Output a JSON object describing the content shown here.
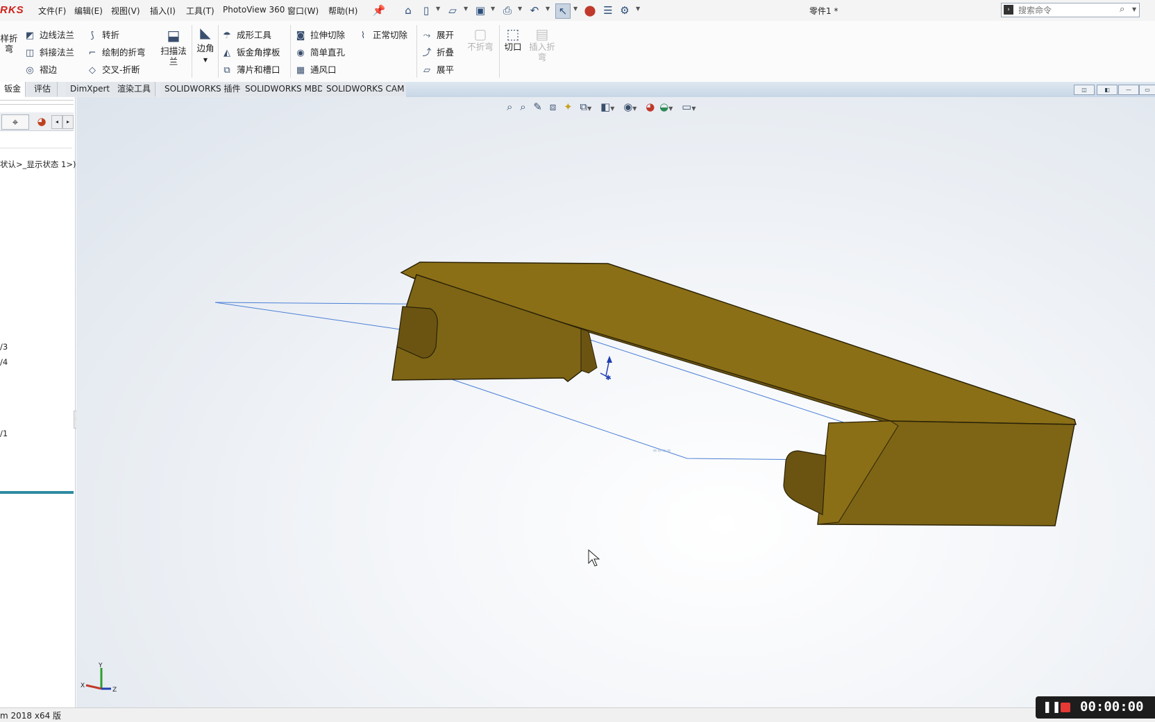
{
  "menubar": {
    "logo_text": "RKS",
    "items": [
      "文件(F)",
      "编辑(E)",
      "视图(V)",
      "插入(I)",
      "工具(T)",
      "PhotoView 360",
      "窗口(W)",
      "帮助(H)"
    ],
    "document_title": "零件1 *",
    "search_placeholder": "搜索命令"
  },
  "ribbon": {
    "col1": [
      "样折",
      "弯"
    ],
    "col2": [
      "边线法兰",
      "斜接法兰",
      "褶边"
    ],
    "col3": [
      "转折",
      "绘制的折弯",
      "交叉-折断"
    ],
    "sweep_flange": [
      "扫描法",
      "兰"
    ],
    "corner": "边角",
    "col5": [
      "成形工具",
      "钣金角撑板",
      "薄片和槽口"
    ],
    "col6": [
      "拉伸切除",
      "简单直孔",
      "通风口"
    ],
    "normal_cut": "正常切除",
    "col7": [
      "展开",
      "折叠",
      "展平"
    ],
    "no_bend": "不折弯",
    "rip": "切口",
    "insert_bends": [
      "插入折",
      "弯"
    ]
  },
  "tabs": [
    "钣金",
    "评估",
    "DimXpert",
    "渲染工具",
    "SOLIDWORKS 插件",
    "SOLIDWORKS MBD",
    "SOLIDWORKS CAM"
  ],
  "tree": {
    "config_text": "状认>_显示状态 1>)",
    "item_a": "/3",
    "item_b": "/4",
    "item_c": "",
    "item_d": "/1"
  },
  "triad": {
    "x": "X",
    "y": "Y",
    "z": "Z"
  },
  "status": {
    "version": "m 2018 x64 版"
  },
  "recorder": {
    "time": "00:00:00"
  },
  "colors": {
    "part": "#8b6f16",
    "part_light": "#9a7c1c",
    "part_dark": "#6b5412",
    "sketch_line": "#4a7fd6",
    "accent": "#d0201a"
  }
}
